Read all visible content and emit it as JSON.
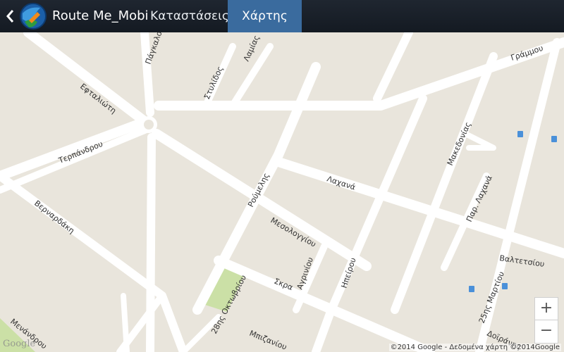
{
  "header": {
    "app_title": "Route Me_Mobi",
    "tabs": [
      {
        "label": "Καταστάσεις",
        "active": false
      },
      {
        "label": "Χάρτης",
        "active": true
      }
    ],
    "accent_color": "#3a6b9e"
  },
  "map": {
    "streets": [
      "Πάγκαλου",
      "Στυλίδος",
      "Λαμίας",
      "Εφταλιώτη",
      "Γράμμου",
      "Τερπάνδρου",
      "Μακεδονίας",
      "Ρούμελης",
      "Λαχανά",
      "Βερναρδάκη",
      "Μεσολογγίου",
      "Παρ. Λαχανά",
      "Βαλτετσίου",
      "Αγρινίου",
      "Ηπείρου",
      "Σκρα",
      "28ης Οκτωβρίου",
      "25ης Μαρτίου",
      "Μπιζανίου",
      "Μενάνδρου",
      "Δοϊράνης"
    ],
    "zoom_in_label": "+",
    "zoom_out_label": "−",
    "attribution": "©2014 Google - Δεδομένα χάρτη ©2014Google",
    "provider_logo": "Google"
  }
}
